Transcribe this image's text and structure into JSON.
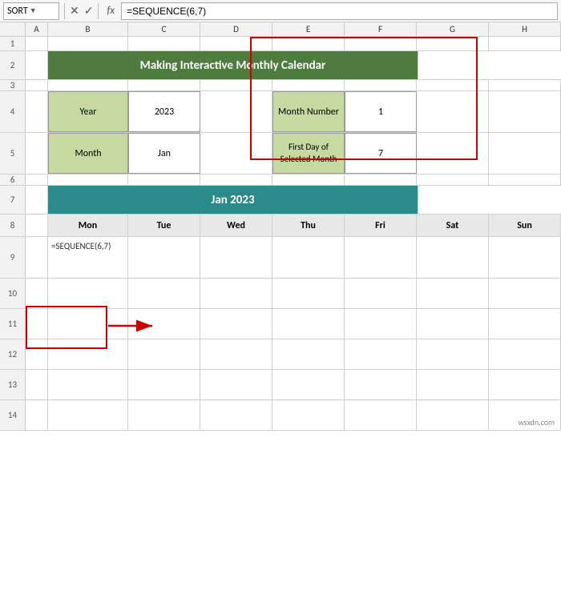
{
  "formulaBar": {
    "nameBox": "SORT",
    "formula": "=SEQUENCE(6,7)",
    "fxLabel": "fx",
    "cancelSymbol": "✕",
    "confirmSymbol": "✓"
  },
  "columns": [
    "A",
    "B",
    "C",
    "D",
    "E",
    "F",
    "G",
    "H"
  ],
  "rows": [
    "1",
    "2",
    "3",
    "4",
    "5",
    "6",
    "7",
    "8",
    "9",
    "10",
    "11",
    "12",
    "13",
    "14"
  ],
  "title": "Making Interactive Monthly Calendar",
  "infoTable": {
    "year_label": "Year",
    "year_value": "2023",
    "month_label": "Month",
    "month_value": "Jan",
    "month_number_label": "Month Number",
    "month_number_value": "1",
    "first_day_label": "First Day of Selected Month",
    "first_day_value": "7"
  },
  "calendarHeader": "Jan 2023",
  "dayHeaders": [
    "Mon",
    "Tue",
    "Wed",
    "Thu",
    "Fri",
    "Sat",
    "Sun"
  ],
  "formulaCell": "=SEQUENCE(6,7)"
}
